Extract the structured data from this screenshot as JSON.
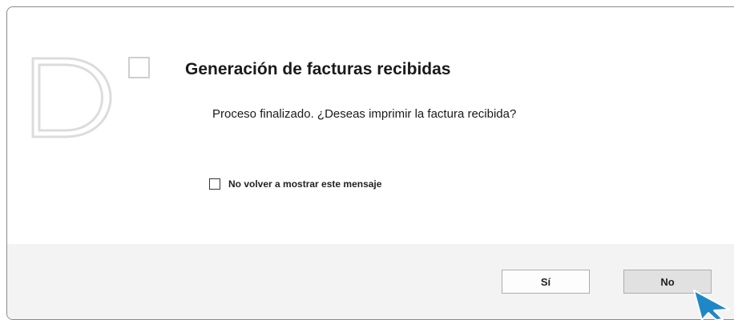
{
  "dialog": {
    "title": "Generación de facturas recibidas",
    "message": "Proceso finalizado. ¿Deseas imprimir la factura recibida?",
    "checkbox": {
      "label": "No volver a mostrar este mensaje",
      "checked": false
    },
    "buttons": {
      "yes_label": "Sí",
      "no_label": "No"
    },
    "logo_icon": "d-logo-icon",
    "cursor_icon": "mouse-pointer-icon"
  },
  "colors": {
    "footer_bg": "#f3f3f3",
    "cursor": "#1e88c7",
    "logo_stroke": "#d9d9d9"
  }
}
